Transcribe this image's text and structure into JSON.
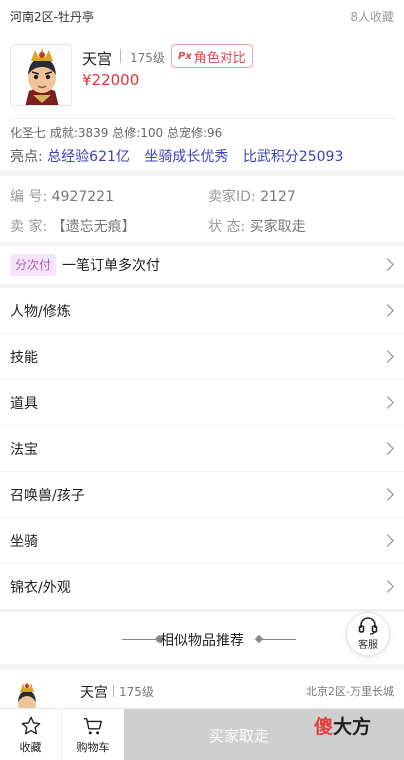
{
  "header": {
    "server": "河南2区-牡丹亭",
    "favorites": "8人收藏"
  },
  "role": {
    "name": "天宫",
    "level": "175级",
    "compare_badge": "Px",
    "compare_label": "角色对比",
    "price": "¥22000",
    "stats": "化圣七 成就:3839 总修:100 总宠修:96",
    "highlight_label": "亮点:",
    "highlights": [
      "总经验621亿",
      "坐骑成长优秀",
      "比武积分25093"
    ]
  },
  "info": {
    "id_label": "编  号:",
    "id_value": "4927221",
    "seller_id_label": "卖家ID:",
    "seller_id_value": "2127",
    "seller_label": "卖  家:",
    "seller_value": "【遗忘无痕】",
    "status_label": "状  态:",
    "status_value": "买家取走"
  },
  "installment": {
    "tag": "分次付",
    "text": "一笔订单多次付"
  },
  "menu": [
    {
      "label": "人物/修炼"
    },
    {
      "label": "技能"
    },
    {
      "label": "道具"
    },
    {
      "label": "法宝"
    },
    {
      "label": "召唤兽/孩子"
    },
    {
      "label": "坐骑"
    },
    {
      "label": "锦衣/外观"
    }
  ],
  "recommend": {
    "title": "相似物品推荐"
  },
  "service": {
    "label": "客服"
  },
  "similar_item": {
    "name": "天宫",
    "level": "175级",
    "server": "北京2区-万里长城"
  },
  "bottom_bar": {
    "favorite_label": "收藏",
    "cart_label": "购物车",
    "buy_label": "买家取走"
  },
  "watermark": {
    "part1": "傻",
    "part2": "大方"
  },
  "colors": {
    "price": "#e0333a",
    "highlight": "#3b3fb8",
    "tag_bg": "#f4e6f8",
    "tag_text": "#b25ac4",
    "buy_disabled": "#cfcfcf"
  }
}
